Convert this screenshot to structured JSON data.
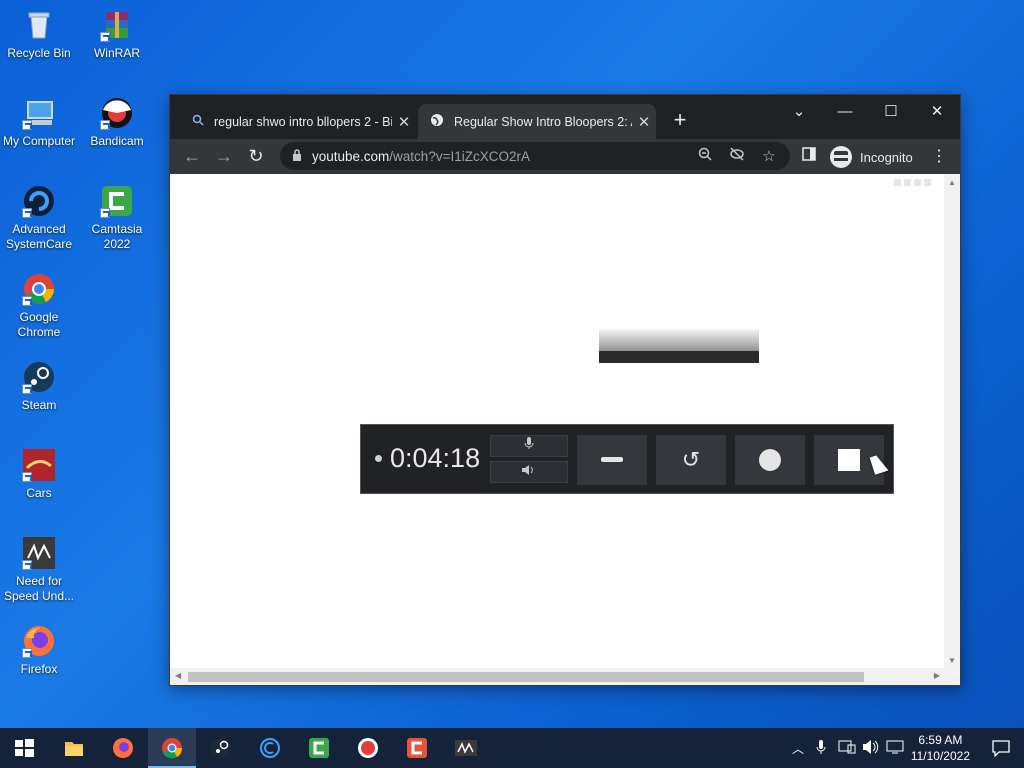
{
  "desktop": {
    "icons": [
      {
        "label": "Recycle Bin"
      },
      {
        "label": "WinRAR"
      },
      {
        "label": "My Computer"
      },
      {
        "label": "Bandicam"
      },
      {
        "label": "Advanced SystemCare"
      },
      {
        "label": "Camtasia 2022"
      },
      {
        "label": "Google Chrome"
      },
      {
        "label": "Steam"
      },
      {
        "label": "Cars"
      },
      {
        "label": "Need for Speed Und..."
      },
      {
        "label": "Firefox"
      }
    ]
  },
  "browser": {
    "tabs": [
      {
        "title": "regular shwo intro bllopers 2 - Bi",
        "icon": "search-icon"
      },
      {
        "title": "Regular Show Intro Bloopers 2: A",
        "icon": "globe-icon"
      }
    ],
    "url_host": "youtube.com",
    "url_path": "/watch?v=I1iZcXCO2rA",
    "incognito_label": "Incognito"
  },
  "recorder": {
    "elapsed": "0:04:18"
  },
  "taskbar": {
    "clock_time": "6:59 AM",
    "clock_date": "11/10/2022"
  },
  "colors": {
    "desktop_bg": "#0b5fd6",
    "taskbar_bg": "#14223a",
    "browser_chrome": "#202124"
  }
}
